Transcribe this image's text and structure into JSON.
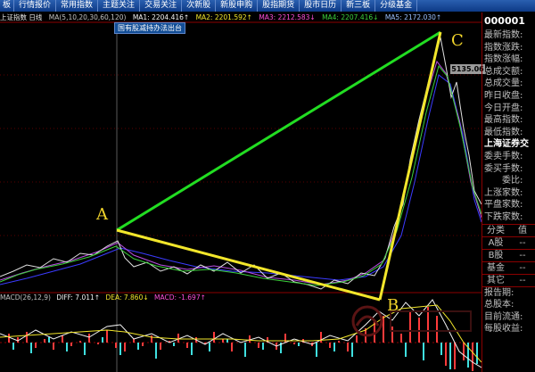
{
  "tabs": [
    "板",
    "行情报价",
    "常用指数",
    "主题关注",
    "交易关注",
    "次新股",
    "新股申购",
    "股指期货",
    "股市日历",
    "新三板",
    "分级基金"
  ],
  "info": {
    "title": "上证指数 日线",
    "params": "MA(5,10,20,30,60,120)",
    "ma1": "MA1: 2204.416↑",
    "ma2": "MA2: 2201.592↑",
    "ma3": "MA3: 2212.583↓",
    "ma4": "MA4: 2207.416↓",
    "ma5": "MA5: 2172.030↑"
  },
  "news_button": "国有股减持办法出台",
  "price_tag": "5135.06",
  "annotations": {
    "a": "A",
    "b": "B",
    "c": "C"
  },
  "macd": {
    "label": "MACD(26,12,9)",
    "diff": "DIFF: 7.011↑",
    "dea": "DEA: 7.860↓",
    "macd": "MACD: -1.697↑"
  },
  "right_panel": {
    "code": "000001",
    "rows": [
      "最新指数:",
      "指数涨跌:",
      "指数涨幅:",
      "总成交额:",
      "总成交量:",
      "昨日收盘:",
      "今日开盘:",
      "最高指数:",
      "最低指数:"
    ],
    "section_title": "上海证券交",
    "rows2": [
      "委卖手数:",
      "委买手数:",
      "委比:",
      "上涨家数:",
      "平盘家数:",
      "下跌家数:"
    ],
    "class_header": {
      "k": "分类",
      "v": "值"
    },
    "classes": [
      {
        "k": "A股",
        "v": "--"
      },
      {
        "k": "B股",
        "v": "--"
      },
      {
        "k": "基金",
        "v": "--"
      },
      {
        "k": "其它",
        "v": "--"
      }
    ],
    "rows3": [
      "报告期:",
      "总股本:",
      "目前流通:",
      "每股收益:"
    ]
  },
  "colors": {
    "tabbar": "#1a4fa0",
    "green_line": "#22dd22",
    "yellow_line": "#f2e62b",
    "macd_pos": "#ff3b3b",
    "macd_neg": "#3fe0e0",
    "grid": "#8b0000"
  }
}
